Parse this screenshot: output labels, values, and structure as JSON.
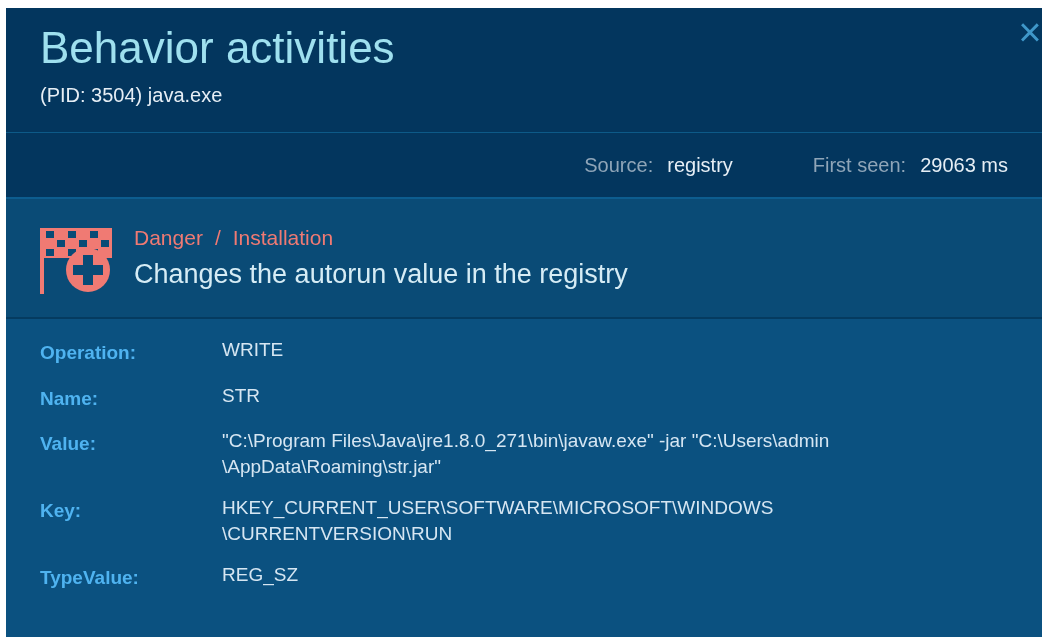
{
  "header": {
    "title": "Behavior activities",
    "subtitle": "(PID: 3504) java.exe",
    "close": "×"
  },
  "meta": [
    {
      "label": "Source:",
      "value": "registry"
    },
    {
      "label": "First seen:",
      "value": "29063 ms"
    }
  ],
  "event": {
    "level": "Danger",
    "separator": "/",
    "category": "Installation",
    "description": "Changes the autorun value in the registry"
  },
  "details": [
    {
      "label": "Operation:",
      "lines": [
        "WRITE"
      ]
    },
    {
      "label": "Name:",
      "lines": [
        "STR"
      ]
    },
    {
      "label": "Value:",
      "lines": [
        "\"C:\\Program Files\\Java\\jre1.8.0_271\\bin\\javaw.exe\" -jar \"C:\\Users\\admin",
        "\\AppData\\Roaming\\str.jar\""
      ]
    },
    {
      "label": "Key:",
      "lines": [
        "HKEY_CURRENT_USER\\SOFTWARE\\MICROSOFT\\WINDOWS",
        "\\CURRENTVERSION\\RUN"
      ]
    },
    {
      "label": "TypeValue:",
      "lines": [
        "REG_SZ"
      ]
    }
  ]
}
